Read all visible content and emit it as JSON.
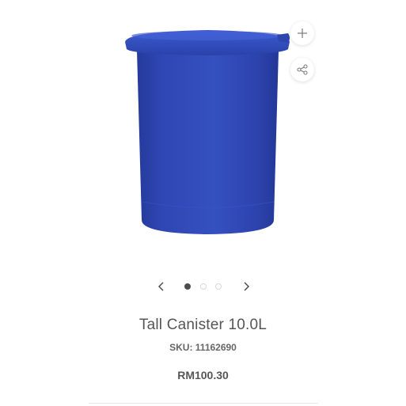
{
  "product": {
    "title": "Tall Canister 10.0L",
    "sku": "SKU: 11162690",
    "price": "RM100.30",
    "image": {
      "description_icon": "blue-canister-image",
      "body_color": "#2f47b0",
      "lid_color": "#3553c4"
    }
  },
  "actions": {
    "zoom_icon": "plus-icon",
    "share_icon": "share-icon"
  },
  "carousel": {
    "prev_icon": "chevron-left-icon",
    "next_icon": "chevron-right-icon",
    "slide_count": 3,
    "active_index": 0,
    "active_color": "#4d4d4d",
    "inactive_color": "#d6d6d6"
  }
}
